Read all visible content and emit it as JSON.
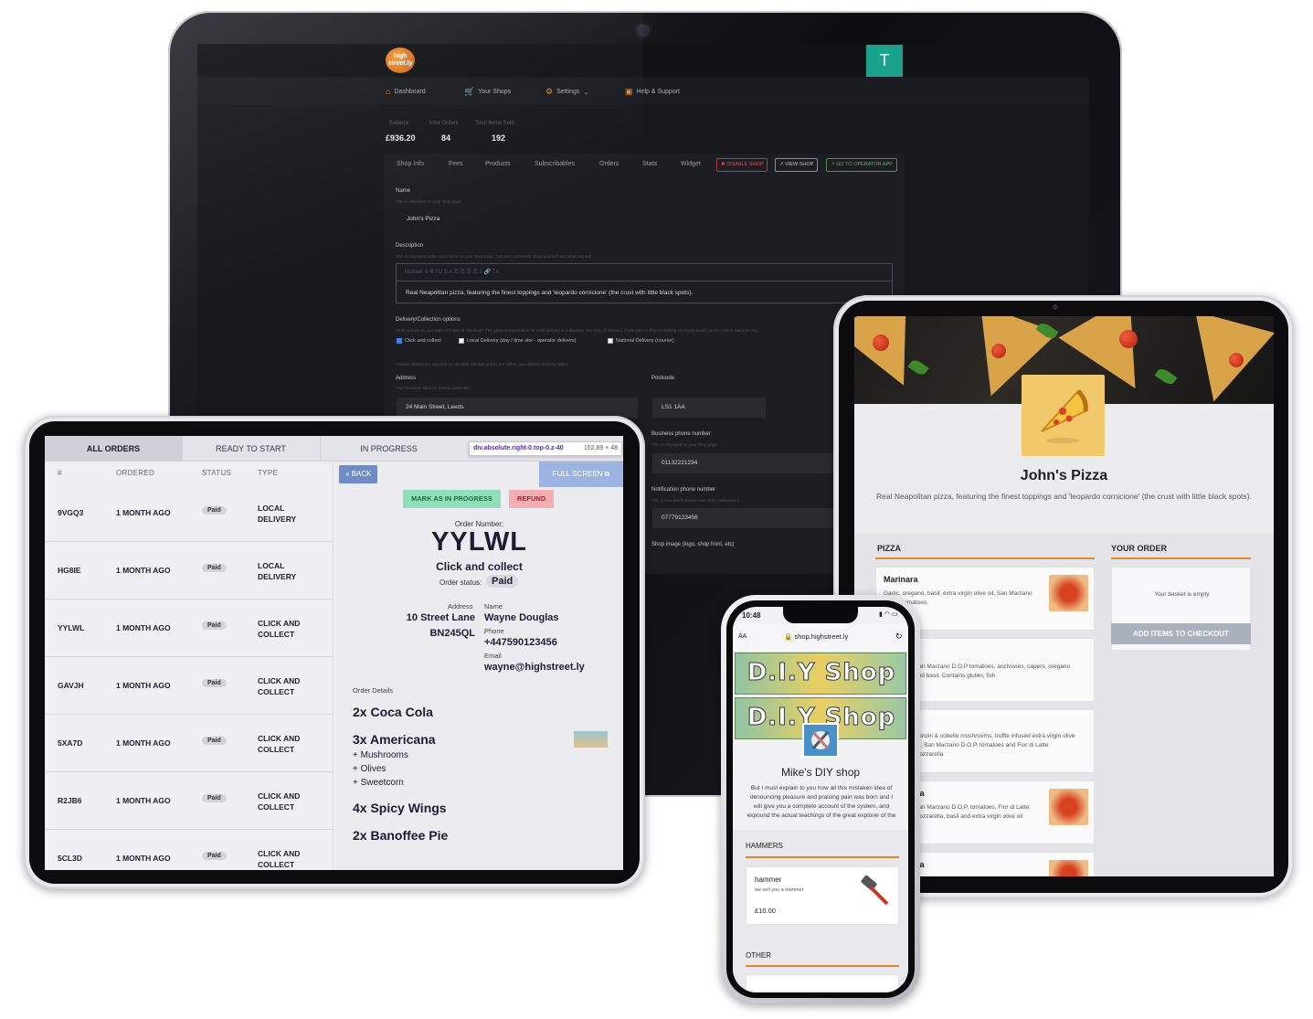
{
  "monitor": {
    "logo_text": "high street.ly",
    "avatar_letter": "T",
    "nav": [
      "Dashboard",
      "Your Shops",
      "Settings",
      "Help & Support"
    ],
    "stats": [
      {
        "label": "Balance",
        "value": "£936.20"
      },
      {
        "label": "Total Orders",
        "value": "84"
      },
      {
        "label": "Total Items Sold",
        "value": "192"
      }
    ],
    "tabs": [
      "Shop Info",
      "Fees",
      "Products",
      "Subscribables",
      "Orders",
      "Stats",
      "Widget"
    ],
    "buttons": {
      "disable": "✖ DISABLE SHOP",
      "view": "↗ VIEW SHOP",
      "operator": "↗ GO TO OPERATOR APP"
    },
    "name_label": "Name",
    "name_hint": "This is displayed on your shop page",
    "name_value": "John's Pizza",
    "description_label": "Description",
    "description_hint": "This is displayed under your name on your shop page. Tell your customers about yourself and what you sell.",
    "editor_toolbar": "Normal ⇕ B I U S A ☰ ☰ ☰ ☰ ≡ 🔗 Tx",
    "description_value": "Real Neapolitan pizza, featuring the finest toppings and 'leopardo cornicione' (the crust with little black spots).",
    "delivery_label": "Delivery/Collection options",
    "delivery_hint": "What options do you want and sale at checkout? The general expectation for local delivery is a day/time slot drop off delivery. If you plan to ship everything via Royal Mail/Couriers, select National only",
    "delivery_options": [
      "Click and collect",
      "Local Delivery (day / time slot - operator delivers)",
      "National Delivery (courier)"
    ],
    "address_hint_top": "Address details are required to calculate whether orders are within your allowed delivery radius",
    "address_label": "Address",
    "address_hint": "Your business address (minus postcode)",
    "address_value": "24 Main Street, Leeds",
    "postcode_label": "Postcode",
    "postcode_value": "LS1 1AA",
    "business_phone_label": "Business phone number",
    "business_phone_hint": "This is displayed on your shop page",
    "business_phone_value": "01132221234",
    "notification_phone_label": "Notification phone number",
    "notification_phone_hint": "This is how you'll receive new order notifications",
    "notification_phone_value": "07779123456",
    "shop_image_label": "Shop image (logo, shop front, etc)"
  },
  "orders_tablet": {
    "tabs": [
      "ALL ORDERS",
      "READY TO START",
      "IN PROGRESS"
    ],
    "tooltip_selector": "div.absolute.right-0.top-0.z-40",
    "tooltip_size": "152.89 × 48",
    "columns": [
      "#",
      "ORDERED",
      "STATUS",
      "TYPE"
    ],
    "rows": [
      {
        "id": "9VGQ3",
        "ordered": "1 MONTH AGO",
        "status": "Paid",
        "type1": "LOCAL",
        "type2": "DELIVERY"
      },
      {
        "id": "HG8IE",
        "ordered": "1 MONTH AGO",
        "status": "Paid",
        "type1": "LOCAL",
        "type2": "DELIVERY"
      },
      {
        "id": "YYLWL",
        "ordered": "1 MONTH AGO",
        "status": "Paid",
        "type1": "CLICK AND",
        "type2": "COLLECT"
      },
      {
        "id": "GAVJH",
        "ordered": "1 MONTH AGO",
        "status": "Paid",
        "type1": "CLICK AND",
        "type2": "COLLECT"
      },
      {
        "id": "5XA7D",
        "ordered": "1 MONTH AGO",
        "status": "Paid",
        "type1": "CLICK AND",
        "type2": "COLLECT"
      },
      {
        "id": "R2JB6",
        "ordered": "1 MONTH AGO",
        "status": "Paid",
        "type1": "CLICK AND",
        "type2": "COLLECT"
      },
      {
        "id": "5CL3D",
        "ordered": "1 MONTH AGO",
        "status": "Paid",
        "type1": "CLICK AND",
        "type2": "COLLECT"
      }
    ],
    "back": "BACK",
    "full_screen": "FULL SCREEN",
    "mark_in_progress": "MARK AS IN PROGRESS",
    "refund": "REFUND",
    "order_number_label": "Order Number:",
    "order_number": "YYLWL",
    "order_type": "Click and collect",
    "order_status_label": "Order status:",
    "order_status": "Paid",
    "address_label": "Address",
    "address_line1": "10 Street Lane",
    "address_line2": "BN245QL",
    "name_label": "Name",
    "name_value": "Wayne Douglas",
    "phone_label": "Phone",
    "phone_value": "+447590123456",
    "email_label": "Email",
    "email_value": "wayne@highstreet.ly",
    "order_details_label": "Order Details",
    "items": [
      {
        "qty": "2x",
        "name": "Coca Cola",
        "extras": []
      },
      {
        "qty": "3x",
        "name": "Americana",
        "extras": [
          "+ Mushrooms",
          "+ Olives",
          "+ Sweetcorn"
        ]
      },
      {
        "qty": "4x",
        "name": "Spicy Wings",
        "extras": []
      },
      {
        "qty": "2x",
        "name": "Banoffee Pie",
        "extras": []
      }
    ]
  },
  "shop_tablet": {
    "title": "John's Pizza",
    "description": "Real Neapolitan pizza, featuring the finest toppings and 'leopardo cornicione' (the crust with little black spots).",
    "section": "PIZZA",
    "order_heading": "YOUR ORDER",
    "basket_empty": "Your basket is empty",
    "checkout": "ADD ITEMS TO CHECKOUT",
    "products": [
      {
        "name": "Marinara",
        "desc": "Garlic, oregano, basil, extra virgin olive oil, San Marzano D.O.P. tomatoes."
      },
      {
        "name": "",
        "desc": "San Marzano D.O.P tomatoes, anchovies, capers, oregano and basil. Contains gluten, fish"
      },
      {
        "name": "",
        "desc": "Porcini & cobello mushrooms, truffle infused extra virgin olive oil, San Marzano D.O.P. tomatoes and Fior di Latte mozzarella"
      },
      {
        "name": "ita",
        "desc": "San Marzano D.O.P. tomatoes, Fior di Latte mozzarella, basil and extra virgin olive oil"
      },
      {
        "name": "na",
        "desc": ""
      }
    ]
  },
  "phone": {
    "time": "10:48",
    "aa": "AA",
    "url": "shop.highstreet.ly",
    "banner_text": "D.I.Y Shop",
    "shop_name": "Mike's DIY shop",
    "description": "But I must explain to you how all this mistaken idea of denouncing pleasure and praising pain was born and I will give you a complete account of the system, and expound the actual teachings of the great explorer of the truth, the",
    "section1": "HAMMERS",
    "product_name": "hammer",
    "product_desc": "we sell you a hammer",
    "product_price": "£10.00",
    "section2": "OTHER"
  }
}
